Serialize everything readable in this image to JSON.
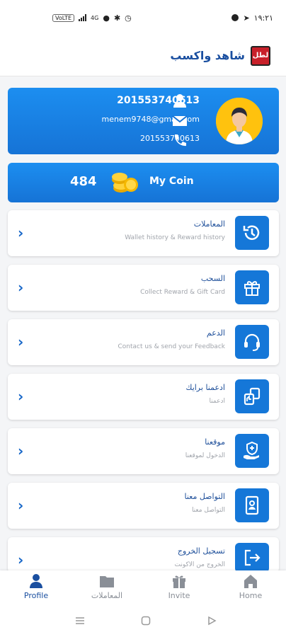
{
  "status_bar": {
    "time": "١٩:٢١",
    "badge": "VoLTE",
    "net": "4G"
  },
  "header": {
    "title": "شاهد واكسب",
    "logo_text": "لطل"
  },
  "profile": {
    "phone": "201553740613",
    "email": "menem9748@gmail.com",
    "phone_secondary": "201553740613"
  },
  "coins": {
    "amount": "484",
    "label": "My Coin"
  },
  "menu": [
    {
      "title": "المعاملات",
      "subtitle": "Wallet history & Reward history",
      "icon": "history-icon"
    },
    {
      "title": "السحب",
      "subtitle": "Collect Reward & Gift Card",
      "icon": "gift-icon"
    },
    {
      "title": "الدعم",
      "subtitle": "Contact us & send your Feedback",
      "icon": "headset-icon"
    },
    {
      "title": "ادعمنا برايك",
      "subtitle": "ادعمنا",
      "icon": "rate-icon"
    },
    {
      "title": "موقعنا",
      "subtitle": "الدخول لموقعنا",
      "icon": "website-icon"
    },
    {
      "title": "التواصل معنا",
      "subtitle": "التواصل معنا",
      "icon": "contact-card-icon"
    },
    {
      "title": "تسجيل الخروج",
      "subtitle": "الخروج من الاكونت",
      "icon": "logout-icon"
    }
  ],
  "bottom_nav": [
    {
      "label": "Profile",
      "active": true
    },
    {
      "label": "المعاملات",
      "active": false
    },
    {
      "label": "Invite",
      "active": false
    },
    {
      "label": "Home",
      "active": false
    }
  ],
  "colors": {
    "primary": "#1577d8",
    "text_dark_blue": "#1e4f9a"
  }
}
